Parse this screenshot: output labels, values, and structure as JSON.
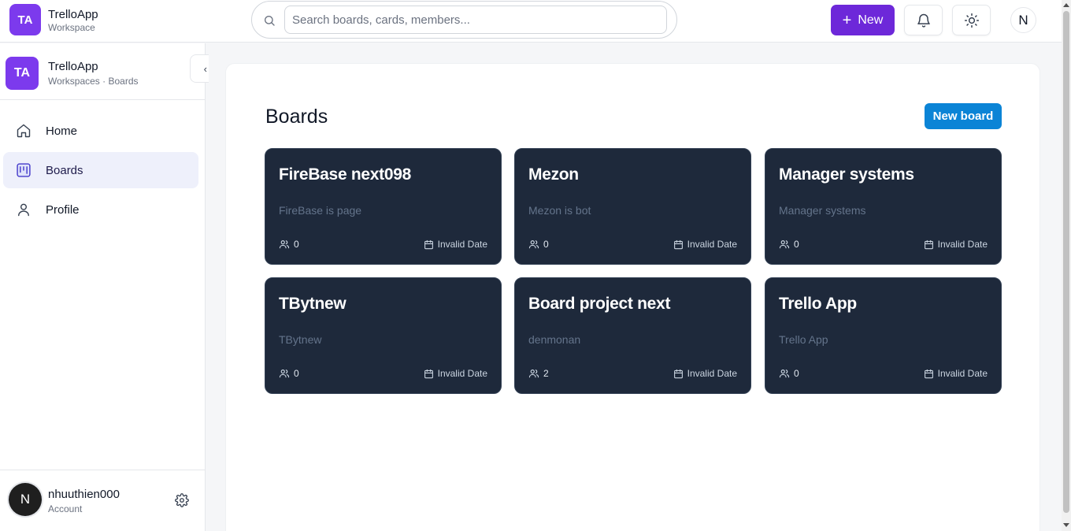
{
  "header": {
    "brand_initials": "TA",
    "brand_name": "TrelloApp",
    "brand_sub": "Workspace",
    "search_placeholder": "Search boards, cards, members...",
    "new_label": "New",
    "avatar_initial": "N"
  },
  "sidebar": {
    "badge_initials": "TA",
    "title": "TrelloApp",
    "subtitle": "Workspaces · Boards",
    "collapse_glyph": "‹",
    "items": [
      {
        "label": "Home",
        "icon": "home-icon",
        "active": false
      },
      {
        "label": "Boards",
        "icon": "boards-icon",
        "active": true
      },
      {
        "label": "Profile",
        "icon": "user-icon",
        "active": false
      }
    ],
    "user": {
      "initial": "N",
      "name": "nhuuthien000",
      "sub": "Account"
    }
  },
  "main": {
    "title": "Boards",
    "new_board_label": "New board",
    "boards": [
      {
        "title": "FireBase next098",
        "description": "FireBase is page",
        "members": "0",
        "date": "Invalid Date"
      },
      {
        "title": "Mezon",
        "description": "Mezon is bot",
        "members": "0",
        "date": "Invalid Date"
      },
      {
        "title": "Manager systems",
        "description": "Manager systems",
        "members": "0",
        "date": "Invalid Date"
      },
      {
        "title": "TBytnew",
        "description": "TBytnew",
        "members": "0",
        "date": "Invalid Date"
      },
      {
        "title": "Board project next",
        "description": "denmonan",
        "members": "2",
        "date": "Invalid Date"
      },
      {
        "title": "Trello App",
        "description": "Trello App",
        "members": "0",
        "date": "Invalid Date"
      }
    ]
  },
  "colors": {
    "brand_purple": "#7c3aed",
    "new_button": "#6d28d9",
    "new_board_button": "#0b84d6",
    "card_bg": "#1e293b",
    "active_nav_bg": "#eef0fb"
  }
}
